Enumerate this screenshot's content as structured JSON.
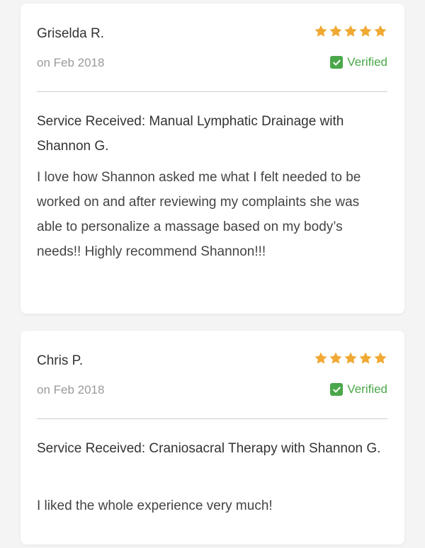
{
  "theme": {
    "star_color": "#f0a933",
    "verified_color": "#4aa74a"
  },
  "reviews": [
    {
      "name": "Griselda R.",
      "rating": 5,
      "date": "on Feb 2018",
      "verified_label": "Verified",
      "service": "Service Received: Manual Lymphatic Drainage with Shannon G.",
      "body": "I love how Shannon asked me what I felt needed to be worked on and after reviewing my complaints she was able to personalize a massage based on my body’s needs!! Highly recommend Shannon!!!"
    },
    {
      "name": "Chris P.",
      "rating": 5,
      "date": "on Feb 2018",
      "verified_label": "Verified",
      "service": "Service Received: Craniosacral Therapy with Shannon G.",
      "body": "I liked the whole experience very much!"
    }
  ]
}
